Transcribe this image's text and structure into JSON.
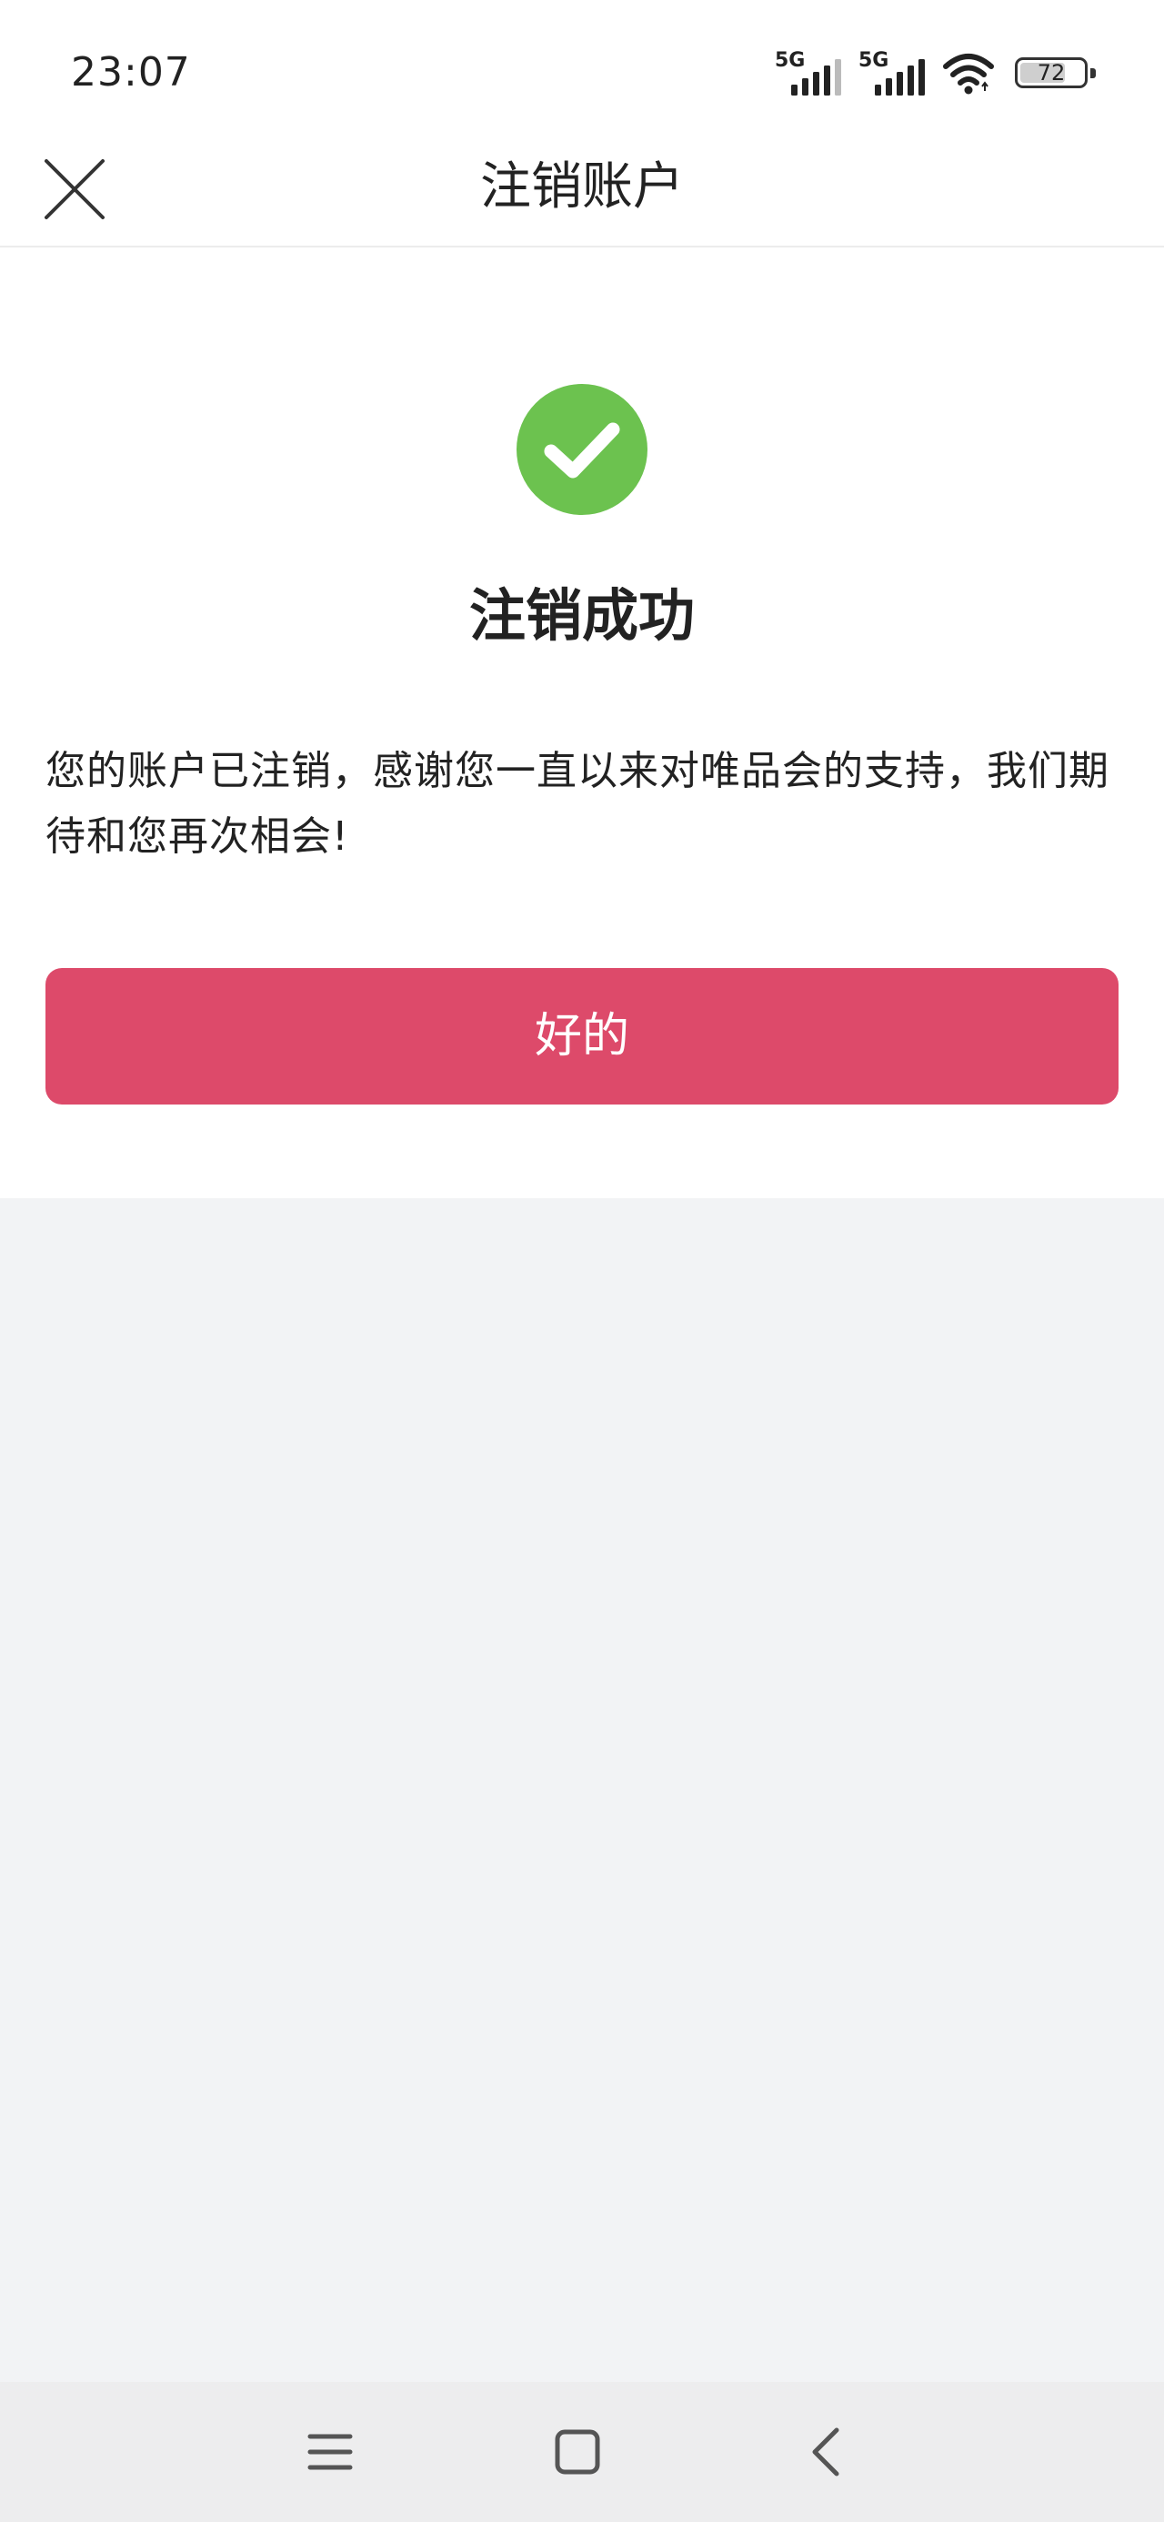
{
  "status_bar": {
    "time": "23:07",
    "sim1_label": "5G",
    "sim2_label": "5G",
    "battery_level": "72",
    "battery_fraction": 0.72,
    "icons": [
      "signal-icon",
      "signal-icon",
      "wifi-icon",
      "battery-icon"
    ]
  },
  "nav_bar": {
    "title": "注销账户",
    "close_icon": "close-icon"
  },
  "result": {
    "icon": "check-circle-icon",
    "title": "注销成功",
    "message": "您的账户已注销，感谢您一直以来对唯品会的支持，我们期待和您再次相会!",
    "ok_label": "好的"
  },
  "system_nav": {
    "icons": [
      "menu-icon",
      "home-icon",
      "back-icon"
    ]
  },
  "colors": {
    "accent": "#dd4a6a",
    "success": "#6cc24f",
    "page_background": "#f2f3f5",
    "card_background": "#ffffff",
    "text": "#222222"
  }
}
